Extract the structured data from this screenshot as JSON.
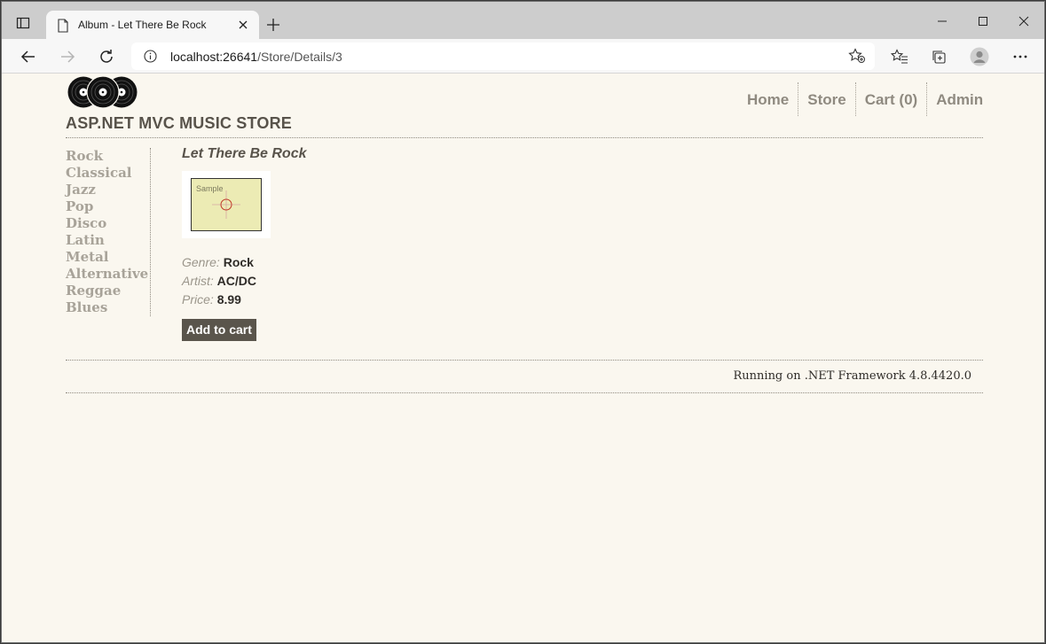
{
  "browser": {
    "tab_title": "Album - Let There Be Rock",
    "url_host": "localhost:26641",
    "url_path": "/Store/Details/3"
  },
  "site": {
    "title": "ASP.NET MVC MUSIC STORE",
    "nav": [
      "Home",
      "Store",
      "Cart (0)",
      "Admin"
    ]
  },
  "genres": [
    "Rock",
    "Classical",
    "Jazz",
    "Pop",
    "Disco",
    "Latin",
    "Metal",
    "Alternative",
    "Reggae",
    "Blues"
  ],
  "album": {
    "title": "Let There Be Rock",
    "art_placeholder": "Sample",
    "genre_label": "Genre:",
    "genre": "Rock",
    "artist_label": "Artist:",
    "artist": "AC/DC",
    "price_label": "Price:",
    "price": "8.99",
    "add_to_cart": "Add to cart"
  },
  "footer": {
    "text": "Running on .NET Framework 4.8.4420.0"
  },
  "colors": {
    "page_bg": "#faf7ef",
    "heading": "#58534b",
    "link_muted": "#a8a399",
    "button_bg": "#5a554c"
  }
}
